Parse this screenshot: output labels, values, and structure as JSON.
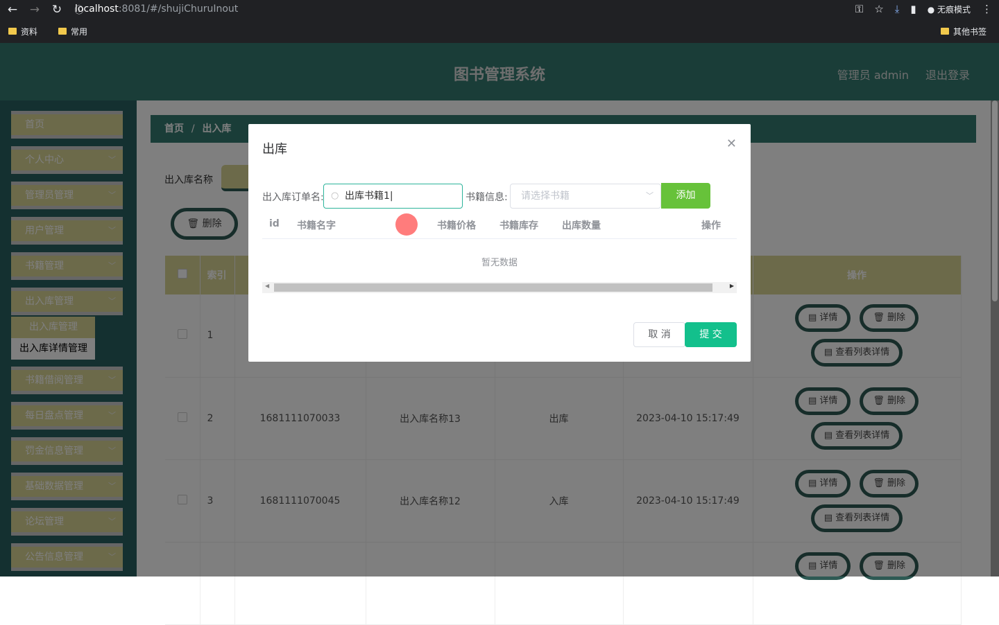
{
  "browser": {
    "url_host": "localhost",
    "url_rest": ":8081/#/shujiChuruInout",
    "incognito": "无痕模式",
    "bookmarks": [
      "资料",
      "常用"
    ],
    "other_bookmarks": "其他书签"
  },
  "header": {
    "title": "图书管理系统",
    "user": "管理员 admin",
    "logout": "退出登录"
  },
  "sidebar": {
    "items": [
      {
        "label": "首页",
        "chevron": false
      },
      {
        "label": "个人中心",
        "chevron": true
      },
      {
        "label": "管理员管理",
        "chevron": true
      },
      {
        "label": "用户管理",
        "chevron": true
      },
      {
        "label": "书籍管理",
        "chevron": true
      },
      {
        "label": "出入库管理",
        "chevron": true
      }
    ],
    "subitems": [
      "出入库管理",
      "出入库详情管理"
    ],
    "items_after": [
      {
        "label": "书籍借阅管理"
      },
      {
        "label": "每日盘点管理"
      },
      {
        "label": "罚金信息管理"
      },
      {
        "label": "基础数据管理"
      },
      {
        "label": "论坛管理"
      },
      {
        "label": "公告信息管理"
      }
    ]
  },
  "breadcrumb": {
    "home": "首页",
    "sep": "/",
    "current": "出入库"
  },
  "search": {
    "label": "出入库名称"
  },
  "toolbar": {
    "delete": "删除"
  },
  "table": {
    "headers": [
      "索引",
      "操作"
    ],
    "rows": [
      {
        "index": "1",
        "order": "",
        "name": "",
        "type": "",
        "time": ""
      },
      {
        "index": "2",
        "order": "1681111070033",
        "name": "出入库名称13",
        "type": "出库",
        "time": "2023-04-10 15:17:49"
      },
      {
        "index": "3",
        "order": "1681111070045",
        "name": "出入库名称12",
        "type": "入库",
        "time": "2023-04-10 15:17:49"
      },
      {
        "index": "",
        "order": "",
        "name": "",
        "type": "",
        "time": ""
      }
    ],
    "ops": {
      "detail": "详情",
      "delete": "删除",
      "list_detail": "查看列表详情"
    }
  },
  "dialog": {
    "title": "出库",
    "order_label": "出入库订单名:",
    "order_value": "出库书籍1",
    "book_label": "书籍信息:",
    "book_placeholder": "请选择书籍",
    "add": "添加",
    "columns": [
      "id",
      "书籍名字",
      "书籍价格",
      "书籍库存",
      "出库数量",
      "操作"
    ],
    "empty": "暂无数据",
    "cancel": "取 消",
    "submit": "提 交"
  }
}
